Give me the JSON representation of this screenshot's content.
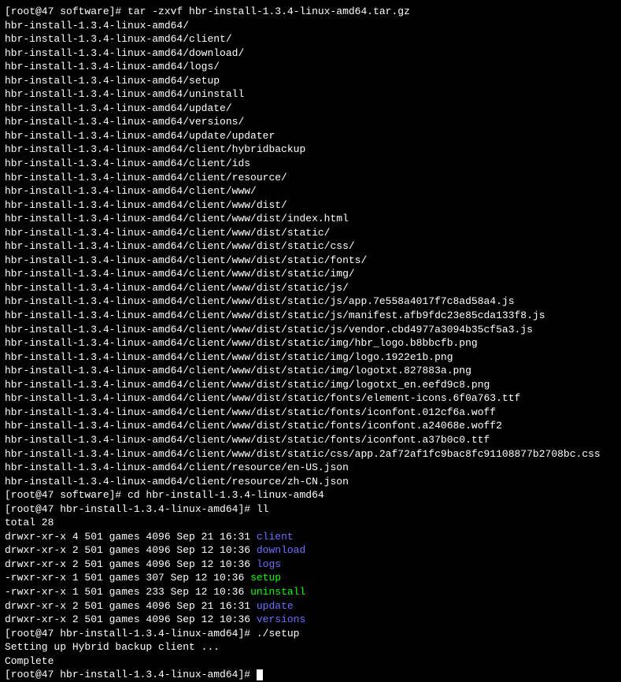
{
  "lines": [
    {
      "prompt": "[root@47 software]# ",
      "command": "tar -zxvf hbr-install-1.3.4-linux-amd64.tar.gz"
    },
    {
      "output": "hbr-install-1.3.4-linux-amd64/"
    },
    {
      "output": "hbr-install-1.3.4-linux-amd64/client/"
    },
    {
      "output": "hbr-install-1.3.4-linux-amd64/download/"
    },
    {
      "output": "hbr-install-1.3.4-linux-amd64/logs/"
    },
    {
      "output": "hbr-install-1.3.4-linux-amd64/setup"
    },
    {
      "output": "hbr-install-1.3.4-linux-amd64/uninstall"
    },
    {
      "output": "hbr-install-1.3.4-linux-amd64/update/"
    },
    {
      "output": "hbr-install-1.3.4-linux-amd64/versions/"
    },
    {
      "output": "hbr-install-1.3.4-linux-amd64/update/updater"
    },
    {
      "output": "hbr-install-1.3.4-linux-amd64/client/hybridbackup"
    },
    {
      "output": "hbr-install-1.3.4-linux-amd64/client/ids"
    },
    {
      "output": "hbr-install-1.3.4-linux-amd64/client/resource/"
    },
    {
      "output": "hbr-install-1.3.4-linux-amd64/client/www/"
    },
    {
      "output": "hbr-install-1.3.4-linux-amd64/client/www/dist/"
    },
    {
      "output": "hbr-install-1.3.4-linux-amd64/client/www/dist/index.html"
    },
    {
      "output": "hbr-install-1.3.4-linux-amd64/client/www/dist/static/"
    },
    {
      "output": "hbr-install-1.3.4-linux-amd64/client/www/dist/static/css/"
    },
    {
      "output": "hbr-install-1.3.4-linux-amd64/client/www/dist/static/fonts/"
    },
    {
      "output": "hbr-install-1.3.4-linux-amd64/client/www/dist/static/img/"
    },
    {
      "output": "hbr-install-1.3.4-linux-amd64/client/www/dist/static/js/"
    },
    {
      "output": "hbr-install-1.3.4-linux-amd64/client/www/dist/static/js/app.7e558a4017f7c8ad58a4.js"
    },
    {
      "output": "hbr-install-1.3.4-linux-amd64/client/www/dist/static/js/manifest.afb9fdc23e85cda133f8.js"
    },
    {
      "output": "hbr-install-1.3.4-linux-amd64/client/www/dist/static/js/vendor.cbd4977a3094b35cf5a3.js"
    },
    {
      "output": "hbr-install-1.3.4-linux-amd64/client/www/dist/static/img/hbr_logo.b8bbcfb.png"
    },
    {
      "output": "hbr-install-1.3.4-linux-amd64/client/www/dist/static/img/logo.1922e1b.png"
    },
    {
      "output": "hbr-install-1.3.4-linux-amd64/client/www/dist/static/img/logotxt.827883a.png"
    },
    {
      "output": "hbr-install-1.3.4-linux-amd64/client/www/dist/static/img/logotxt_en.eefd9c8.png"
    },
    {
      "output": "hbr-install-1.3.4-linux-amd64/client/www/dist/static/fonts/element-icons.6f0a763.ttf"
    },
    {
      "output": "hbr-install-1.3.4-linux-amd64/client/www/dist/static/fonts/iconfont.012cf6a.woff"
    },
    {
      "output": "hbr-install-1.3.4-linux-amd64/client/www/dist/static/fonts/iconfont.a24068e.woff2"
    },
    {
      "output": "hbr-install-1.3.4-linux-amd64/client/www/dist/static/fonts/iconfont.a37b0c0.ttf"
    },
    {
      "output": "hbr-install-1.3.4-linux-amd64/client/www/dist/static/css/app.2af72af1fc9bac8fc91108877b2708bc.css"
    },
    {
      "output": "hbr-install-1.3.4-linux-amd64/client/resource/en-US.json"
    },
    {
      "output": "hbr-install-1.3.4-linux-amd64/client/resource/zh-CN.json"
    },
    {
      "prompt": "[root@47 software]# ",
      "command": "cd hbr-install-1.3.4-linux-amd64"
    },
    {
      "prompt": "[root@47 hbr-install-1.3.4-linux-amd64]# ",
      "command": "ll"
    },
    {
      "output": "total 28"
    },
    {
      "ls": {
        "perms": "drwxr-xr-x 4 501 games  4096 Sep 21 16:31 ",
        "name": "client",
        "color": "blue"
      }
    },
    {
      "ls": {
        "perms": "drwxr-xr-x 2 501 games  4096 Sep 12 10:36 ",
        "name": "download",
        "color": "blue"
      }
    },
    {
      "ls": {
        "perms": "drwxr-xr-x 2 501 games  4096 Sep 12 10:36 ",
        "name": "logs",
        "color": "blue"
      }
    },
    {
      "ls": {
        "perms": "-rwxr-xr-x 1 501 games   307 Sep 12 10:36 ",
        "name": "setup",
        "color": "green"
      }
    },
    {
      "ls": {
        "perms": "-rwxr-xr-x 1 501 games   233 Sep 12 10:36 ",
        "name": "uninstall",
        "color": "green"
      }
    },
    {
      "ls": {
        "perms": "drwxr-xr-x 2 501 games  4096 Sep 21 16:31 ",
        "name": "update",
        "color": "blue"
      }
    },
    {
      "ls": {
        "perms": "drwxr-xr-x 2 501 games  4096 Sep 12 10:36 ",
        "name": "versions",
        "color": "blue"
      }
    },
    {
      "prompt": "[root@47 hbr-install-1.3.4-linux-amd64]# ",
      "command": "./setup"
    },
    {
      "output": "Setting up Hybrid backup client ..."
    },
    {
      "output": "Complete"
    },
    {
      "prompt": "[root@47 hbr-install-1.3.4-linux-amd64]# ",
      "command": "",
      "cursor": true
    }
  ]
}
